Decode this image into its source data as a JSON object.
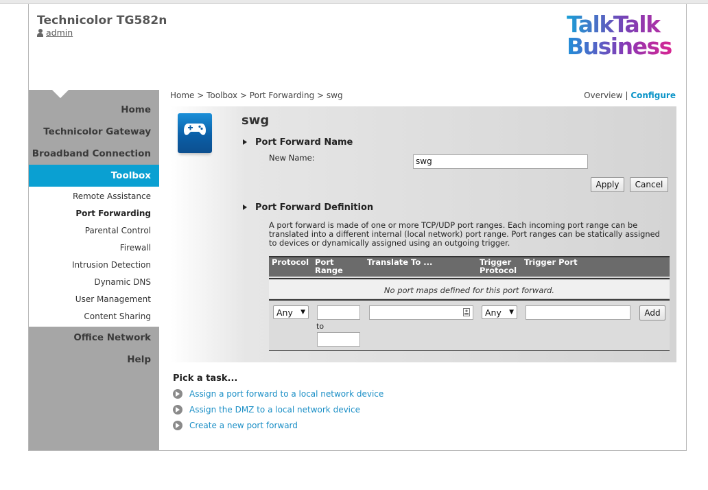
{
  "header": {
    "device_title": "Technicolor TG582n",
    "user": "admin",
    "logo_line1": "TalkTalk",
    "logo_line2": "Business"
  },
  "sidebar": {
    "main_items": [
      "Home",
      "Technicolor Gateway",
      "Broadband Connection"
    ],
    "active": "Toolbox",
    "sub_items": [
      "Remote Assistance",
      "Port Forwarding",
      "Parental Control",
      "Firewall",
      "Intrusion Detection",
      "Dynamic DNS",
      "User Management",
      "Content Sharing"
    ],
    "selected_sub": "Port Forwarding",
    "bottom_items": [
      "Office Network",
      "Help"
    ]
  },
  "breadcrumb": "Home > Toolbox > Port Forwarding > swg",
  "views": {
    "overview": "Overview",
    "separator": "|",
    "configure": "Configure"
  },
  "panel": {
    "title": "swg",
    "name_section": {
      "heading": "Port Forward Name",
      "new_name_label": "New Name:",
      "new_name_value": "swg",
      "apply_label": "Apply",
      "cancel_label": "Cancel"
    },
    "definition_section": {
      "heading": "Port Forward Definition",
      "description": "A port forward is made of one or more TCP/UDP port ranges. Each incoming port range can be translated into a different internal (local network) port range. Port ranges can be statically assigned to devices or dynamically assigned using an outgoing trigger.",
      "columns": [
        "Protocol",
        "Port Range",
        "Translate To ...",
        "Trigger Protocol",
        "Trigger Port"
      ],
      "empty_message": "No port maps defined for this port forward.",
      "protocol_value": "Any",
      "to_label": "to",
      "trigger_protocol_value": "Any",
      "add_label": "Add"
    }
  },
  "tasks": {
    "title": "Pick a task...",
    "items": [
      "Assign a port forward to a local network device",
      "Assign the DMZ to a local network device",
      "Create a new port forward"
    ]
  },
  "colors": {
    "accent": "#0aa0d2",
    "sidebar_bg": "#a6a6a6",
    "link": "#1b8fc6",
    "table_header": "#6b6b6b"
  }
}
